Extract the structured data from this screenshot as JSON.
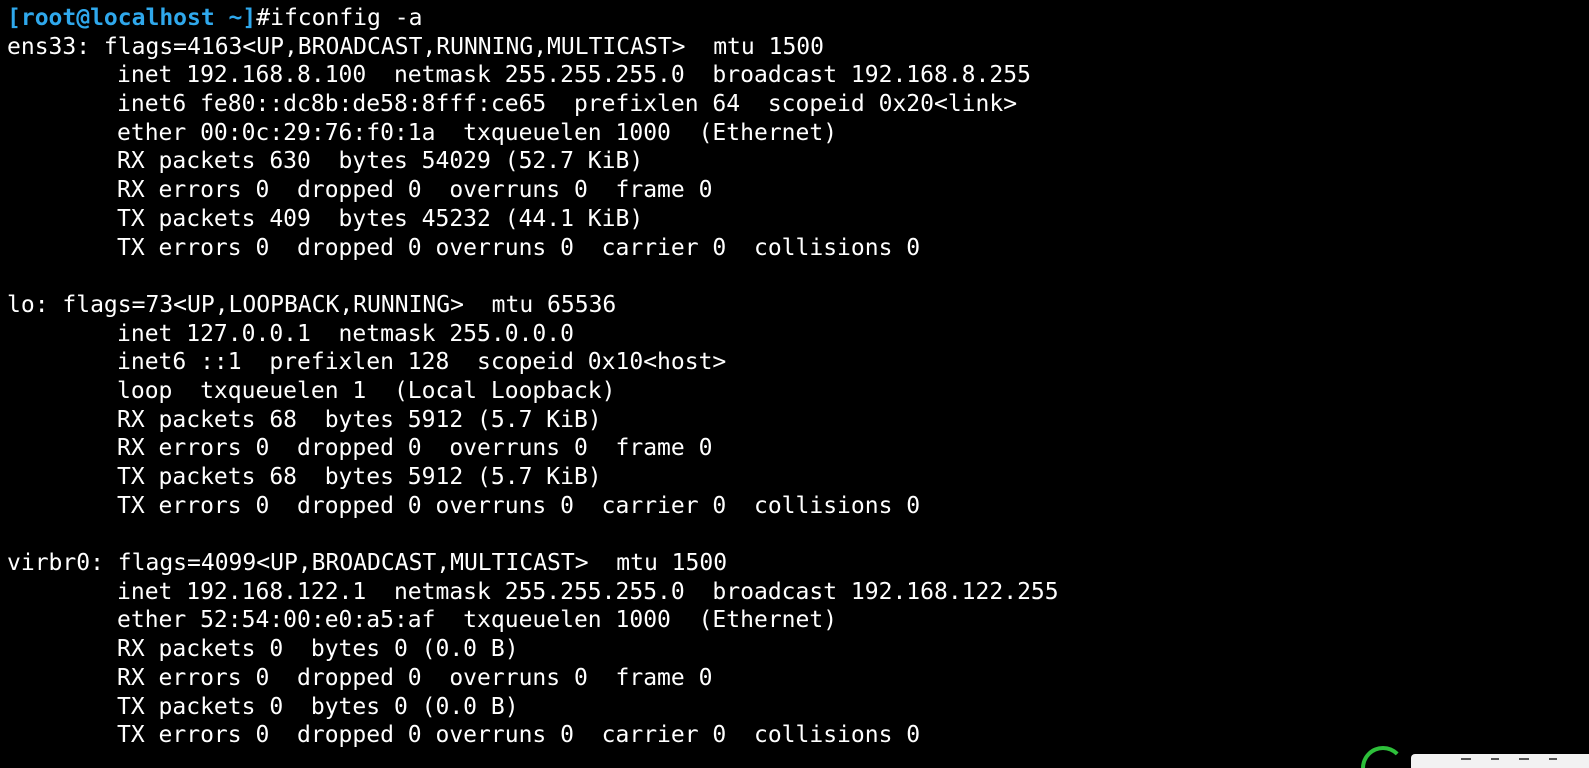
{
  "terminal": {
    "prompt": "[root@localhost ~]",
    "command": "#ifconfig -a",
    "lines": [
      {
        "indent": false,
        "text": "ens33: flags=4163<UP,BROADCAST,RUNNING,MULTICAST>  mtu 1500"
      },
      {
        "indent": true,
        "text": "inet 192.168.8.100  netmask 255.255.255.0  broadcast 192.168.8.255"
      },
      {
        "indent": true,
        "text": "inet6 fe80::dc8b:de58:8fff:ce65  prefixlen 64  scopeid 0x20<link>"
      },
      {
        "indent": true,
        "text": "ether 00:0c:29:76:f0:1a  txqueuelen 1000  (Ethernet)"
      },
      {
        "indent": true,
        "text": "RX packets 630  bytes 54029 (52.7 KiB)"
      },
      {
        "indent": true,
        "text": "RX errors 0  dropped 0  overruns 0  frame 0"
      },
      {
        "indent": true,
        "text": "TX packets 409  bytes 45232 (44.1 KiB)"
      },
      {
        "indent": true,
        "text": "TX errors 0  dropped 0 overruns 0  carrier 0  collisions 0"
      },
      {
        "indent": false,
        "text": ""
      },
      {
        "indent": false,
        "text": "lo: flags=73<UP,LOOPBACK,RUNNING>  mtu 65536"
      },
      {
        "indent": true,
        "text": "inet 127.0.0.1  netmask 255.0.0.0"
      },
      {
        "indent": true,
        "text": "inet6 ::1  prefixlen 128  scopeid 0x10<host>"
      },
      {
        "indent": true,
        "text": "loop  txqueuelen 1  (Local Loopback)"
      },
      {
        "indent": true,
        "text": "RX packets 68  bytes 5912 (5.7 KiB)"
      },
      {
        "indent": true,
        "text": "RX errors 0  dropped 0  overruns 0  frame 0"
      },
      {
        "indent": true,
        "text": "TX packets 68  bytes 5912 (5.7 KiB)"
      },
      {
        "indent": true,
        "text": "TX errors 0  dropped 0 overruns 0  carrier 0  collisions 0"
      },
      {
        "indent": false,
        "text": ""
      },
      {
        "indent": false,
        "text": "virbr0: flags=4099<UP,BROADCAST,MULTICAST>  mtu 1500"
      },
      {
        "indent": true,
        "text": "inet 192.168.122.1  netmask 255.255.255.0  broadcast 192.168.122.255"
      },
      {
        "indent": true,
        "text": "ether 52:54:00:e0:a5:af  txqueuelen 1000  (Ethernet)"
      },
      {
        "indent": true,
        "text": "RX packets 0  bytes 0 (0.0 B)"
      },
      {
        "indent": true,
        "text": "RX errors 0  dropped 0  overruns 0  frame 0"
      },
      {
        "indent": true,
        "text": "TX packets 0  bytes 0 (0.0 B)"
      },
      {
        "indent": true,
        "text": "TX errors 0  dropped 0 overruns 0  carrier 0  collisions 0"
      }
    ]
  },
  "colors": {
    "background": "#000000",
    "foreground": "#ffffff",
    "prompt": "#2fa8ec",
    "widget_accent": "#2dbf3a"
  },
  "icons": {
    "corner_widget": "green-ring-icon"
  }
}
